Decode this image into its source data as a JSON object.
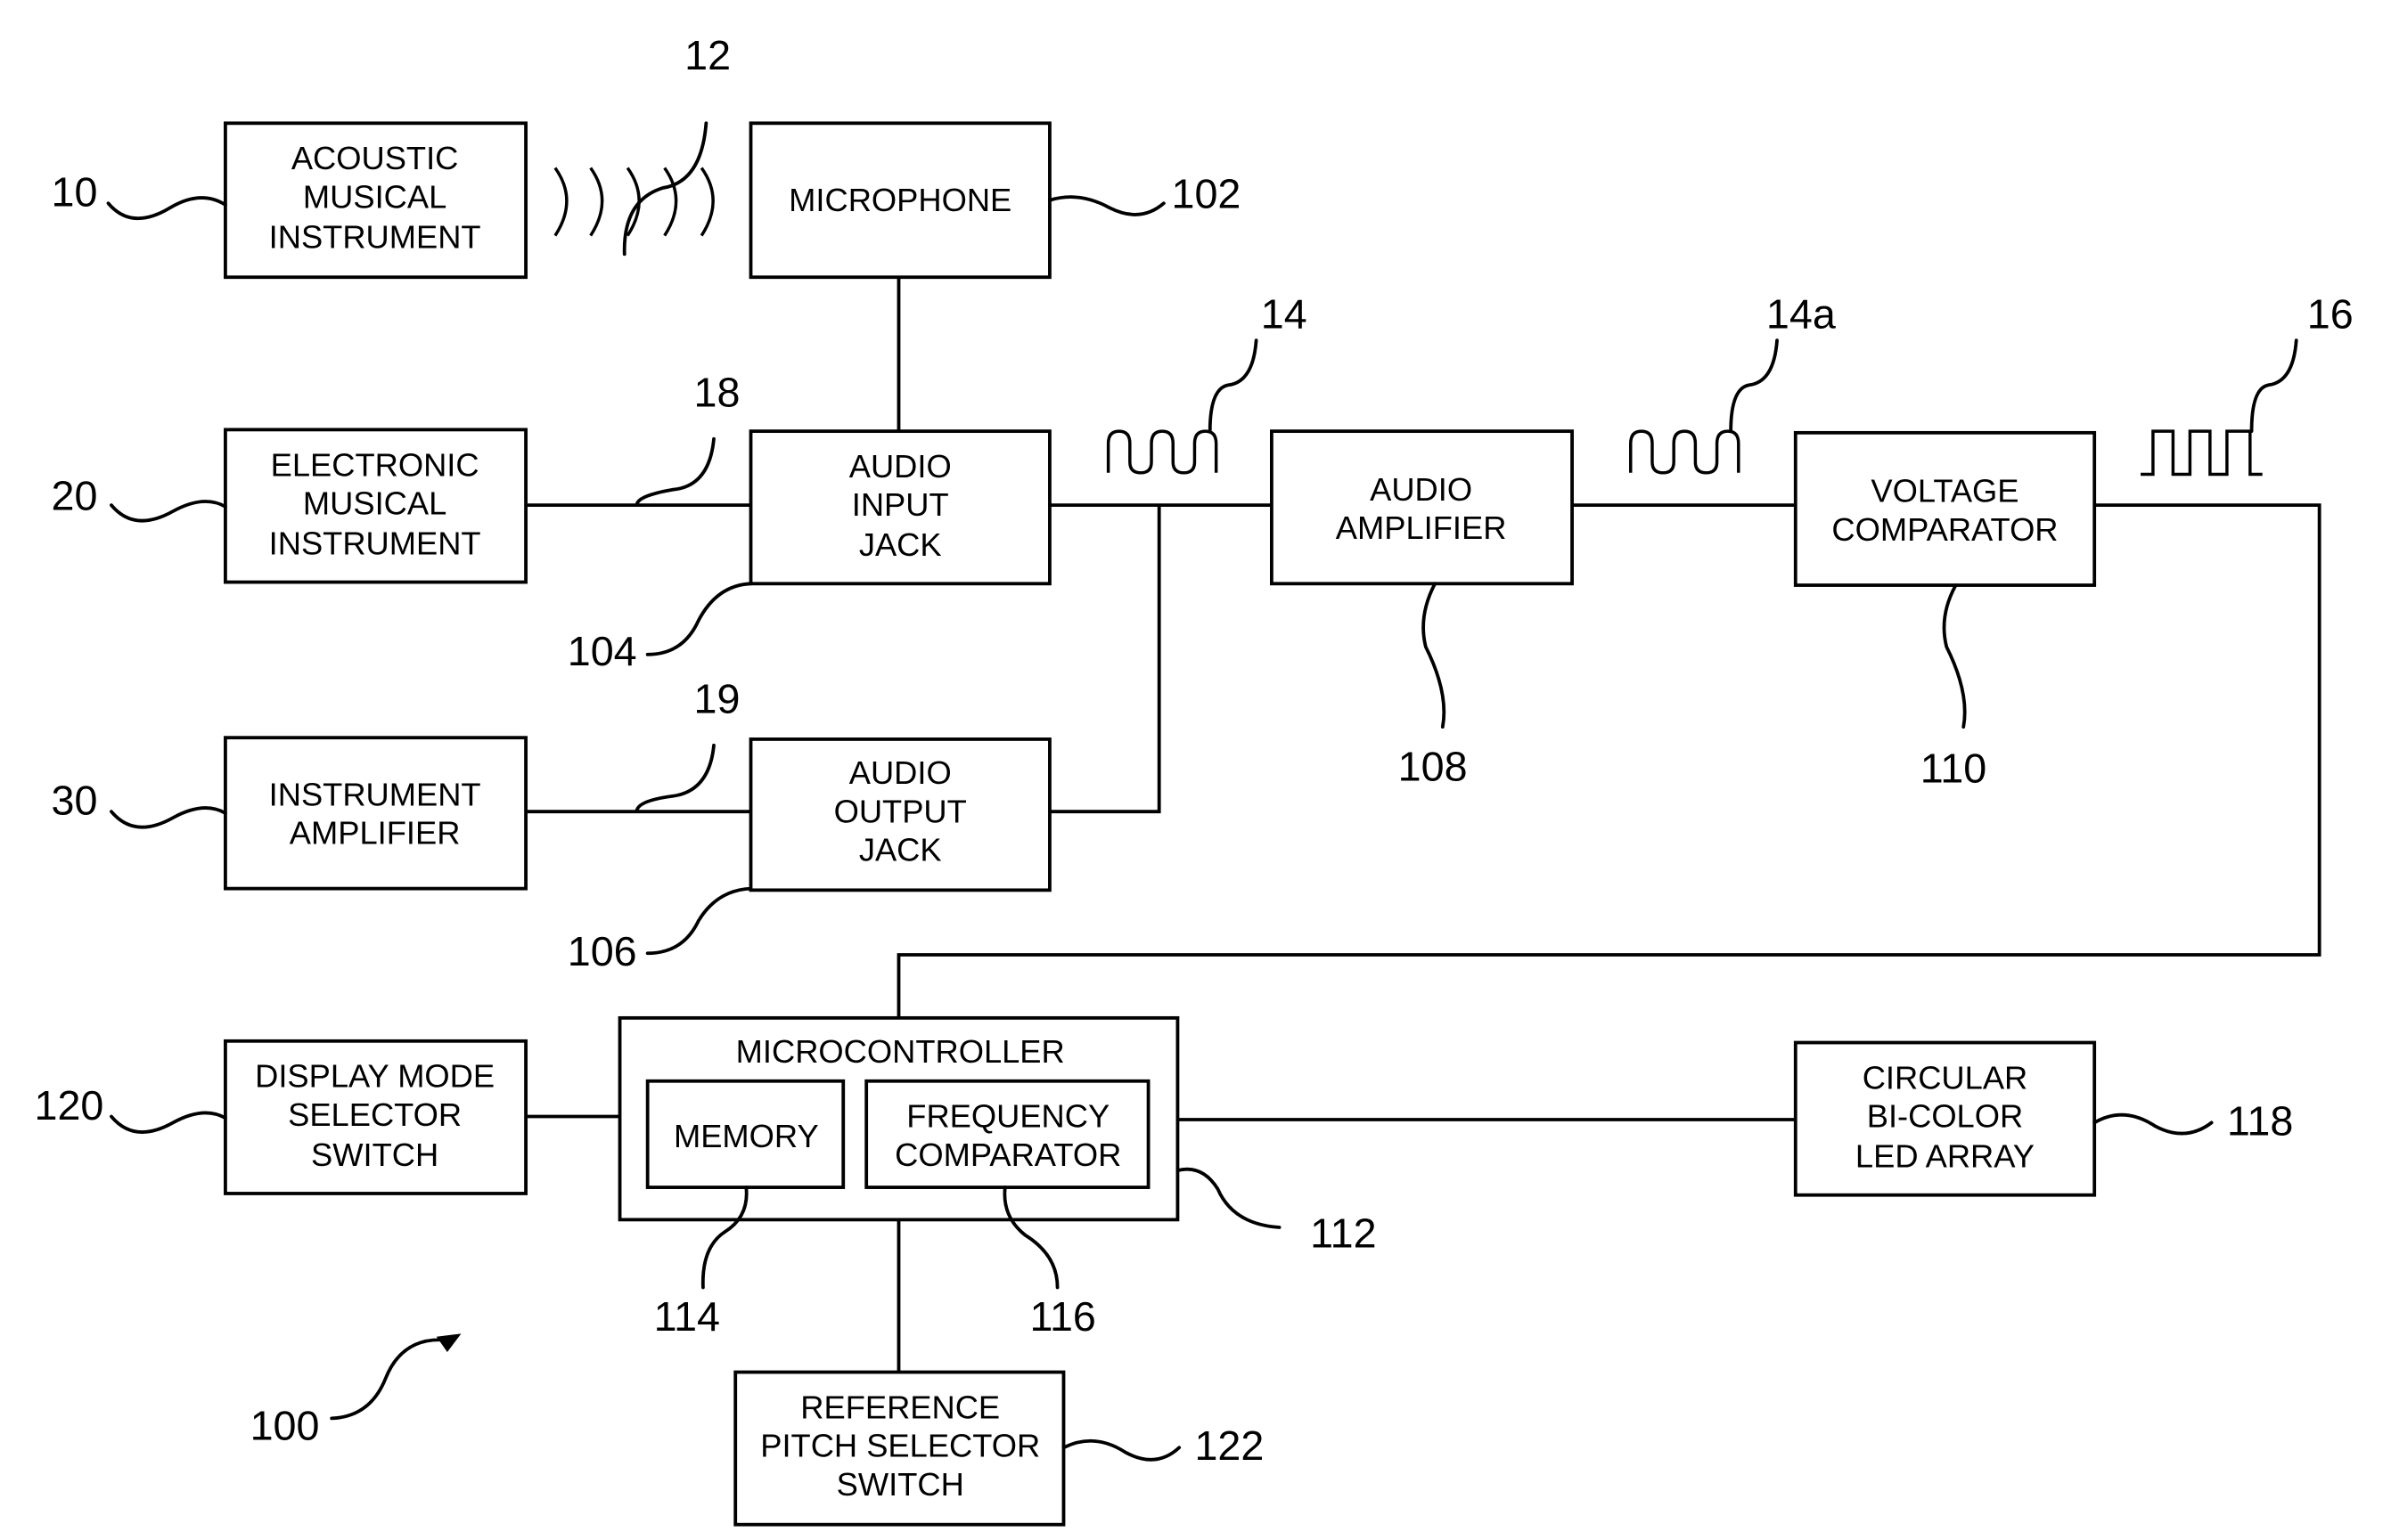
{
  "diagram": {
    "system_ref": "100",
    "blocks": {
      "acoustic": {
        "ref": "10",
        "lines": [
          "ACOUSTIC",
          "MUSICAL",
          "INSTRUMENT"
        ]
      },
      "electronic": {
        "ref": "20",
        "lines": [
          "ELECTRONIC",
          "MUSICAL",
          "INSTRUMENT"
        ]
      },
      "instrument_amp": {
        "ref": "30",
        "lines": [
          "INSTRUMENT",
          "AMPLIFIER"
        ]
      },
      "microphone": {
        "ref": "102",
        "lines": [
          "MICROPHONE"
        ]
      },
      "audio_input_jack": {
        "ref": "104",
        "lines": [
          "AUDIO",
          "INPUT",
          "JACK"
        ]
      },
      "audio_output_jack": {
        "ref": "106",
        "lines": [
          "AUDIO",
          "OUTPUT",
          "JACK"
        ]
      },
      "audio_amplifier": {
        "ref": "108",
        "lines": [
          "AUDIO",
          "AMPLIFIER"
        ]
      },
      "voltage_comparator": {
        "ref": "110",
        "lines": [
          "VOLTAGE",
          "COMPARATOR"
        ]
      },
      "microcontroller": {
        "ref": "112",
        "lines": [
          "MICROCONTROLLER"
        ]
      },
      "memory": {
        "ref": "114",
        "lines": [
          "MEMORY"
        ]
      },
      "frequency_comparator": {
        "ref": "116",
        "lines": [
          "FREQUENCY",
          "COMPARATOR"
        ]
      },
      "led_array": {
        "ref": "118",
        "lines": [
          "CIRCULAR",
          "BI-COLOR",
          "LED ARRAY"
        ]
      },
      "display_mode_switch": {
        "ref": "120",
        "lines": [
          "DISPLAY MODE",
          "SELECTOR",
          "SWITCH"
        ]
      },
      "reference_pitch_switch": {
        "ref": "122",
        "lines": [
          "REFERENCE",
          "PITCH SELECTOR",
          "SWITCH"
        ]
      }
    },
    "signals": {
      "sound_waves": "12",
      "cable_electronic": "18",
      "cable_amp": "19",
      "audio_signal": "14",
      "amplified_signal": "14a",
      "square_wave": "16"
    }
  }
}
